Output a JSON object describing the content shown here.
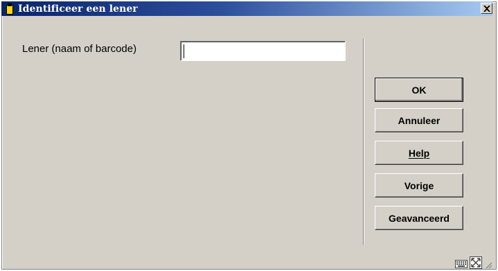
{
  "window": {
    "title": "Identificeer een lener",
    "close_glyph": "x"
  },
  "form": {
    "label": "Lener (naam of barcode)",
    "value": "",
    "placeholder": ""
  },
  "buttons": {
    "ok": "OK",
    "cancel": "Annuleer",
    "help": "Help",
    "previous": "Vorige",
    "advanced": "Geavanceerd"
  },
  "icons": [
    "document-icon",
    "close-icon",
    "keyboard-icon",
    "expand-icon",
    "resize-grip-icon"
  ],
  "colors": {
    "titlebar_start": "#0a246a",
    "titlebar_end": "#a6caf0",
    "face": "#d4d0c8"
  }
}
